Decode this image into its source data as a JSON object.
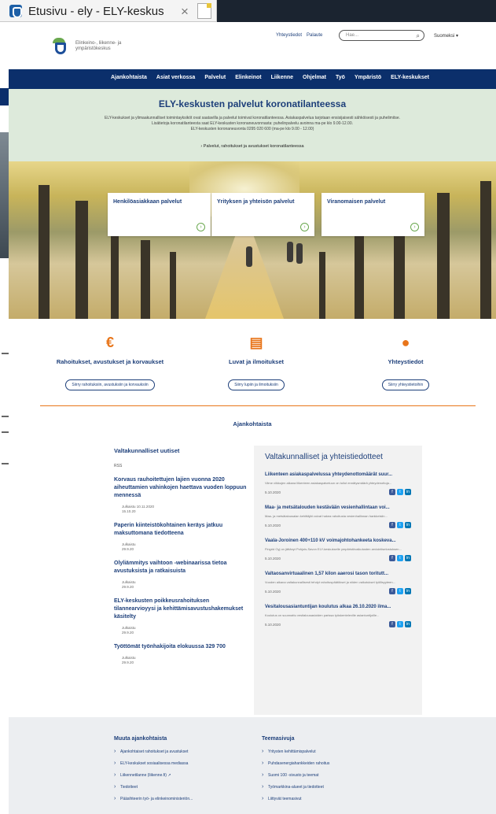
{
  "browser": {
    "tab_title": "Etusivu - ely - ELY-keskus",
    "close_glyph": "×"
  },
  "header": {
    "logo_text": "Elinkeino-, liikenne- ja ympäristökeskus",
    "links": [
      "Yhteystiedot",
      "Palaute"
    ],
    "search_placeholder": "Hae...",
    "search_icon": "⌕",
    "language": "Suomeksi ▾"
  },
  "nav": {
    "items": [
      "Ajankohtaista",
      "Asiat verkossa",
      "Palvelut",
      "Elinkeinot",
      "Liikenne",
      "Ohjelmat",
      "Työ",
      "Ympäristö",
      "ELY-keskukset"
    ]
  },
  "notice": {
    "title": "ELY-keskusten palvelut koronatilanteessa",
    "body": "ELY-keskukset ja ylimaakunnalliset toimintayksiköt ovat saatavilla ja palvelut toimivat koronatilanteessa. Asiakaspalvelua tarjotaan ensisijaisesti sähköisesti ja puhelimitse. Lisätietoja koronatilanteesta saat ELY-keskusten koronaneuvonnasta: puhelinpalvelu avoinna ma-pe klo 9.00-12.00.",
    "phone": "ELY-keskusten koronaneuvonta 0295 020 600 (ma-pe klo 9.00 - 12.00)",
    "link": "› Palvelut, rahoitukset ja avustukset koronatilanteessa"
  },
  "hero": {
    "cards": [
      {
        "title": "Henkilöasiakkaan palvelut",
        "go": "›"
      },
      {
        "title": "Yrityksen ja yhteisön palvelut",
        "go": "›"
      },
      {
        "title": "Viranomaisen palvelut",
        "go": "›"
      }
    ]
  },
  "quick": [
    {
      "icon": "€",
      "title": "Rahoitukset, avustukset ja korvaukset",
      "button": "Siirry rahoituksiin, avustuksiin ja korvauksiin"
    },
    {
      "icon": "▤",
      "title": "Luvat ja ilmoitukset",
      "button": "Siirry lupiin ja ilmoituksiin"
    },
    {
      "icon": "●",
      "title": "Yhteystiedot",
      "button": "Siirry yhteystietoihin"
    }
  ],
  "ajankohtaista": {
    "title": "Ajankohtaista"
  },
  "news": {
    "head": "Valtakunnalliset uutiset",
    "rss": "RSS",
    "items": [
      {
        "title": "Korvaus rauhoitettujen lajien vuonna 2020 aiheuttamien vahinkojen haettava vuoden loppuun mennessä",
        "date": "Julkaistu 10.11.2020",
        "time": "15.10.20"
      },
      {
        "title": "Paperin kiinteistökohtainen keräys jatkuu maksuttomana tiedotteena",
        "date": "Julkaistu",
        "time": "29.9.20"
      },
      {
        "title": "Olyliämmitys vaihtoon -webinaarissa tietoa avustuksista ja ratkaisuista",
        "date": "Julkaistu",
        "time": "29.9.20"
      },
      {
        "title": "ELY-keskusten poikkeusrahoituksen tilannearvioyysi ja kehittämisavustushakemukset käsitelty",
        "date": "Julkaistu",
        "time": "29.9.20"
      },
      {
        "title": "Työttömät työnhakijoita elokuussa 329 700",
        "date": "Julkaistu",
        "time": "29.9.20"
      }
    ]
  },
  "aside": {
    "head": "Valtakunnalliset ja yhteistiedotteet",
    "items": [
      {
        "title": "Liikenteen asiakaspalvelussa yhteydenottomäärät suur...",
        "desc": "Viime viikkojen aikana liikenteen asiakaspalveluun on tullut ennätysmäärä yhteydenottoja...",
        "date": "5.10.2020"
      },
      {
        "title": "Maa- ja metsätalouden kestävään vesienhallintaan voi...",
        "desc": "Maa- ja metsätalousalan kehittäjät voivat hakea rahoitusta vesienhallinnan hankkeisiin...",
        "date": "5.10.2020"
      },
      {
        "title": "Vaala-Joroinen 400+110 kV voimajohtohankeeta koskeva...",
        "desc": "Fingrid Oyj on jättänyt Pohjois-Savon ELY-keskukselle ympäristövaikutusten arviointiselostuksen...",
        "date": "5.10.2020"
      },
      {
        "title": "Valtaosanvirtuaalinen 1,57 kilon aaerosi tason toritutt...",
        "desc": "Vuoden aikana valtakunnallisesti tehdyt rahoituspäätökset ja niiden vaikutukset työllisyyteen...",
        "date": "5.10.2020"
      },
      {
        "title": "Vesitalousasiantuntijan koulutus alkaa 26.10.2020 ilma...",
        "desc": "Koulutus on suunnattu vesitalousasioiden parissa työskenteleville asiantuntijoille...",
        "date": "5.10.2020"
      }
    ],
    "social": [
      "f",
      "t",
      "in"
    ]
  },
  "footer": {
    "col1": {
      "head": "Muuta ajankohtaista",
      "items": [
        "Ajankohtaiset rahoitukset ja avustukset",
        "ELY-keskukset sosiaalisessa mediassa",
        "Liikennetilanne (liikenne.fi) ↗",
        "Tiedotteet",
        "Pääsihteerin työ- ja elinkeinoministeriön..."
      ]
    },
    "col2": {
      "head": "Teemasivuja",
      "items": [
        "Yritysten kehittämispalvelut",
        "Puhdasenergiahankkeiden rahoitus",
        "Suomi 100 -sivusto ja teemat",
        "Työmarkkina-alueet ja tiedotteet",
        "Liittyvät teemasivut"
      ]
    }
  },
  "colors": {
    "navy": "#0b2f6b",
    "accent": "#e8751a",
    "green": "#6aa84f",
    "notice_bg": "#ddeadb"
  }
}
